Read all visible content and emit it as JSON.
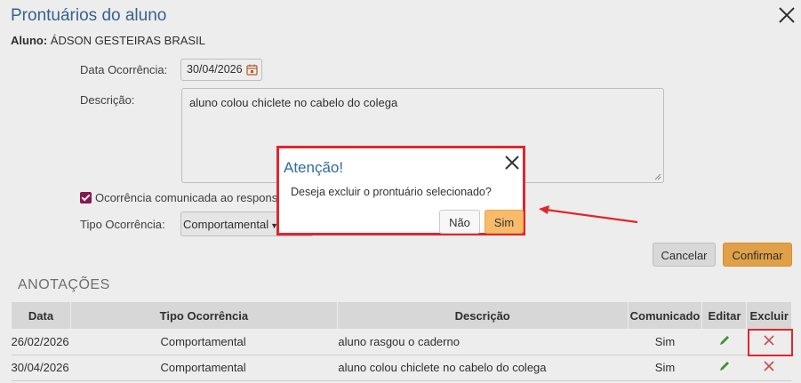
{
  "modal": {
    "title": "Prontuários do aluno",
    "student_label": "Aluno:",
    "student_name": "ÁDSON GESTEIRAS BRASIL"
  },
  "form": {
    "date_label": "Data Ocorrência:",
    "date_value": "30/04/2026",
    "description_label": "Descrição:",
    "description_value": "aluno colou chiclete no cabelo do colega",
    "checkbox_label": "Ocorrência comunicada ao respons",
    "type_label": "Tipo Ocorrência:",
    "type_value": "Comportamental"
  },
  "actions": {
    "cancel": "Cancelar",
    "confirm": "Confirmar"
  },
  "annotations": {
    "title": "ANOTAÇÕES",
    "columns": [
      "Data",
      "Tipo Ocorrência",
      "Descrição",
      "Comunicado",
      "Editar",
      "Excluir"
    ],
    "rows": [
      {
        "date": "26/02/2026",
        "type": "Comportamental",
        "description": "aluno rasgou o caderno",
        "communicated": "Sim"
      },
      {
        "date": "30/04/2026",
        "type": "Comportamental",
        "description": "aluno colou chiclete no cabelo do colega",
        "communicated": "Sim"
      }
    ]
  },
  "dialog": {
    "title": "Atenção!",
    "message": "Deseja excluir o prontuário selecionado?",
    "no": "Não",
    "yes": "Sim"
  },
  "colors": {
    "title_blue": "#3b6a9a",
    "confirm_orange": "#f0ad4e",
    "highlight_red": "#e0262e",
    "edit_green": "#4a9a3c",
    "delete_red": "#d9534f",
    "checkbox_purple": "#8e1b53"
  },
  "icons": [
    "close-icon",
    "calendar-icon",
    "pencil-icon",
    "delete-x-icon",
    "arrow-icon"
  ]
}
